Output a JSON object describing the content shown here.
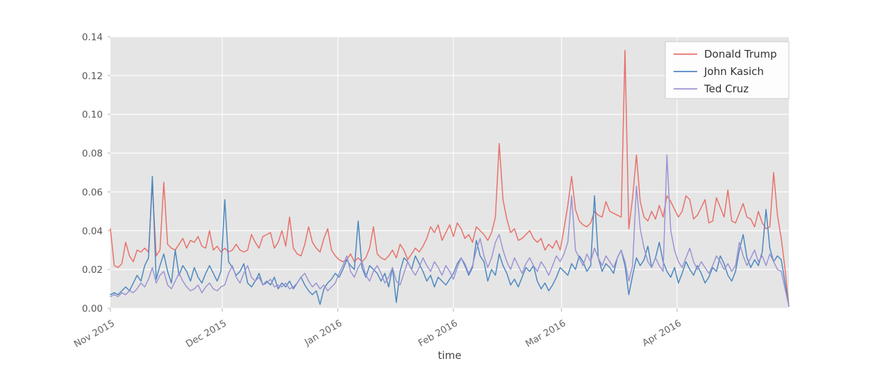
{
  "chart_data": {
    "type": "line",
    "title": "",
    "xlabel": "time",
    "ylabel": "",
    "ylim": [
      0.0,
      0.14
    ],
    "yticks": [
      "0.00",
      "0.02",
      "0.04",
      "0.06",
      "0.08",
      "0.10",
      "0.12",
      "0.14"
    ],
    "ytick_values": [
      0.0,
      0.02,
      0.04,
      0.06,
      0.08,
      0.1,
      0.12,
      0.14
    ],
    "xticks": [
      "Nov 2015",
      "Dec 2015",
      "Jan 2016",
      "Feb 2016",
      "Mar 2016",
      "Apr 2016"
    ],
    "xtick_positions": [
      0,
      30,
      61,
      92,
      121,
      152
    ],
    "xlim": [
      0,
      182
    ],
    "grid": true,
    "grid_color": "#ffffff",
    "plot_bgcolor": "#e5e5e5",
    "figure_bgcolor": "#ffffff",
    "legend_position": "top-right",
    "xtick_rotation": -30,
    "x_unit": "days since Nov 1 2015",
    "series": [
      {
        "name": "Donald Trump",
        "color": "#e8706a",
        "values": [
          0.041,
          0.022,
          0.021,
          0.023,
          0.034,
          0.027,
          0.024,
          0.03,
          0.029,
          0.031,
          0.029,
          0.064,
          0.027,
          0.03,
          0.065,
          0.033,
          0.031,
          0.03,
          0.033,
          0.036,
          0.031,
          0.035,
          0.034,
          0.037,
          0.032,
          0.031,
          0.04,
          0.03,
          0.032,
          0.029,
          0.031,
          0.029,
          0.03,
          0.033,
          0.03,
          0.029,
          0.03,
          0.038,
          0.034,
          0.031,
          0.037,
          0.038,
          0.039,
          0.031,
          0.034,
          0.04,
          0.032,
          0.047,
          0.031,
          0.028,
          0.027,
          0.033,
          0.042,
          0.034,
          0.031,
          0.029,
          0.036,
          0.041,
          0.03,
          0.027,
          0.025,
          0.024,
          0.025,
          0.028,
          0.024,
          0.026,
          0.024,
          0.026,
          0.031,
          0.042,
          0.028,
          0.026,
          0.025,
          0.027,
          0.03,
          0.026,
          0.033,
          0.03,
          0.025,
          0.028,
          0.031,
          0.029,
          0.032,
          0.036,
          0.042,
          0.039,
          0.043,
          0.035,
          0.039,
          0.043,
          0.037,
          0.044,
          0.041,
          0.036,
          0.038,
          0.034,
          0.042,
          0.04,
          0.038,
          0.035,
          0.039,
          0.047,
          0.085,
          0.056,
          0.046,
          0.039,
          0.041,
          0.035,
          0.036,
          0.038,
          0.04,
          0.036,
          0.034,
          0.036,
          0.03,
          0.033,
          0.031,
          0.035,
          0.03,
          0.041,
          0.053,
          0.068,
          0.051,
          0.045,
          0.043,
          0.042,
          0.044,
          0.05,
          0.048,
          0.047,
          0.055,
          0.05,
          0.049,
          0.048,
          0.047,
          0.133,
          0.041,
          0.057,
          0.079,
          0.055,
          0.047,
          0.045,
          0.05,
          0.046,
          0.053,
          0.047,
          0.058,
          0.055,
          0.051,
          0.047,
          0.05,
          0.058,
          0.056,
          0.046,
          0.048,
          0.052,
          0.056,
          0.044,
          0.045,
          0.057,
          0.052,
          0.047,
          0.061,
          0.045,
          0.044,
          0.049,
          0.054,
          0.047,
          0.046,
          0.042,
          0.05,
          0.044,
          0.041,
          0.042,
          0.07,
          0.048,
          0.036,
          0.02,
          0.001
        ]
      },
      {
        "name": "John Kasich",
        "color": "#4b87bf",
        "values": [
          0.007,
          0.008,
          0.007,
          0.009,
          0.011,
          0.009,
          0.013,
          0.017,
          0.014,
          0.022,
          0.026,
          0.068,
          0.015,
          0.022,
          0.028,
          0.019,
          0.013,
          0.03,
          0.017,
          0.022,
          0.019,
          0.014,
          0.021,
          0.016,
          0.013,
          0.018,
          0.022,
          0.018,
          0.014,
          0.019,
          0.056,
          0.024,
          0.021,
          0.017,
          0.019,
          0.023,
          0.013,
          0.011,
          0.014,
          0.018,
          0.012,
          0.014,
          0.012,
          0.016,
          0.01,
          0.013,
          0.011,
          0.014,
          0.01,
          0.013,
          0.016,
          0.012,
          0.009,
          0.007,
          0.009,
          0.002,
          0.01,
          0.013,
          0.015,
          0.018,
          0.016,
          0.02,
          0.025,
          0.022,
          0.02,
          0.045,
          0.021,
          0.016,
          0.022,
          0.02,
          0.018,
          0.014,
          0.018,
          0.011,
          0.021,
          0.003,
          0.019,
          0.026,
          0.024,
          0.02,
          0.027,
          0.023,
          0.019,
          0.014,
          0.017,
          0.011,
          0.016,
          0.014,
          0.012,
          0.015,
          0.018,
          0.023,
          0.026,
          0.022,
          0.017,
          0.021,
          0.035,
          0.027,
          0.024,
          0.014,
          0.02,
          0.017,
          0.028,
          0.022,
          0.018,
          0.012,
          0.015,
          0.011,
          0.016,
          0.021,
          0.019,
          0.022,
          0.014,
          0.01,
          0.013,
          0.009,
          0.012,
          0.016,
          0.021,
          0.019,
          0.017,
          0.023,
          0.02,
          0.027,
          0.024,
          0.019,
          0.022,
          0.058,
          0.026,
          0.019,
          0.023,
          0.021,
          0.018,
          0.026,
          0.03,
          0.022,
          0.007,
          0.017,
          0.026,
          0.022,
          0.025,
          0.032,
          0.021,
          0.026,
          0.034,
          0.024,
          0.019,
          0.016,
          0.021,
          0.013,
          0.018,
          0.024,
          0.02,
          0.017,
          0.022,
          0.018,
          0.013,
          0.016,
          0.021,
          0.019,
          0.027,
          0.023,
          0.017,
          0.014,
          0.019,
          0.03,
          0.038,
          0.026,
          0.021,
          0.025,
          0.022,
          0.029,
          0.051,
          0.031,
          0.024,
          0.027,
          0.025,
          0.013,
          0.001
        ]
      },
      {
        "name": "Ted Cruz",
        "color": "#9b93d3",
        "values": [
          0.006,
          0.007,
          0.006,
          0.008,
          0.007,
          0.009,
          0.008,
          0.01,
          0.013,
          0.011,
          0.015,
          0.021,
          0.013,
          0.017,
          0.019,
          0.012,
          0.01,
          0.014,
          0.018,
          0.014,
          0.011,
          0.009,
          0.01,
          0.012,
          0.008,
          0.011,
          0.013,
          0.01,
          0.009,
          0.011,
          0.012,
          0.018,
          0.022,
          0.016,
          0.013,
          0.018,
          0.022,
          0.016,
          0.014,
          0.016,
          0.012,
          0.013,
          0.015,
          0.011,
          0.012,
          0.011,
          0.013,
          0.01,
          0.011,
          0.013,
          0.016,
          0.018,
          0.014,
          0.011,
          0.013,
          0.01,
          0.012,
          0.009,
          0.011,
          0.013,
          0.018,
          0.022,
          0.027,
          0.019,
          0.016,
          0.021,
          0.024,
          0.017,
          0.014,
          0.019,
          0.022,
          0.018,
          0.013,
          0.016,
          0.021,
          0.014,
          0.012,
          0.018,
          0.024,
          0.02,
          0.017,
          0.021,
          0.026,
          0.022,
          0.019,
          0.024,
          0.021,
          0.017,
          0.022,
          0.019,
          0.015,
          0.021,
          0.026,
          0.023,
          0.018,
          0.022,
          0.03,
          0.036,
          0.027,
          0.021,
          0.026,
          0.034,
          0.038,
          0.03,
          0.024,
          0.02,
          0.026,
          0.022,
          0.018,
          0.023,
          0.026,
          0.022,
          0.019,
          0.024,
          0.021,
          0.017,
          0.022,
          0.027,
          0.024,
          0.028,
          0.034,
          0.058,
          0.03,
          0.026,
          0.022,
          0.028,
          0.024,
          0.031,
          0.026,
          0.022,
          0.027,
          0.024,
          0.021,
          0.026,
          0.03,
          0.024,
          0.014,
          0.022,
          0.063,
          0.041,
          0.031,
          0.024,
          0.021,
          0.026,
          0.022,
          0.019,
          0.079,
          0.04,
          0.03,
          0.024,
          0.021,
          0.026,
          0.031,
          0.024,
          0.02,
          0.024,
          0.021,
          0.018,
          0.022,
          0.027,
          0.024,
          0.02,
          0.023,
          0.019,
          0.022,
          0.034,
          0.027,
          0.022,
          0.026,
          0.03,
          0.024,
          0.027,
          0.022,
          0.028,
          0.024,
          0.02,
          0.019,
          0.01,
          0.001
        ]
      }
    ]
  }
}
